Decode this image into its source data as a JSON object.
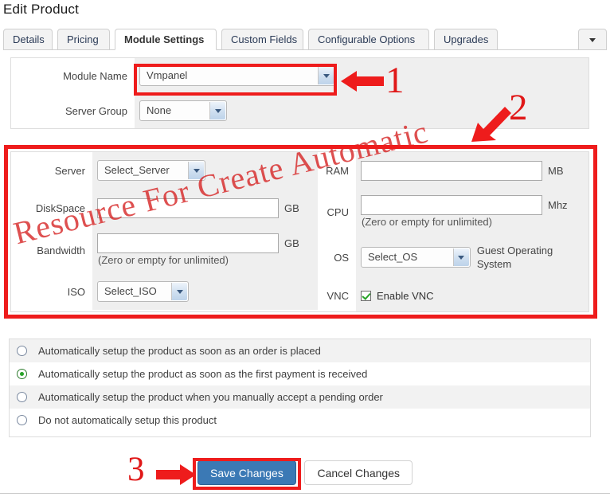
{
  "header": {
    "title": "Edit Product"
  },
  "tabs": {
    "items": [
      {
        "label": "Details",
        "active": false
      },
      {
        "label": "Pricing",
        "active": false
      },
      {
        "label": "Module Settings",
        "active": true
      },
      {
        "label": "Custom Fields",
        "active": false
      },
      {
        "label": "Configurable Options",
        "active": false
      },
      {
        "label": "Upgrades",
        "active": false
      }
    ],
    "overflow_icon": "chevron-down-icon"
  },
  "module_panel": {
    "module_name": {
      "label": "Module Name",
      "value": "Vmpanel"
    },
    "server_group": {
      "label": "Server Group",
      "value": "None"
    }
  },
  "resource_panel": {
    "server": {
      "label": "Server",
      "value": "Select_Server"
    },
    "diskspace": {
      "label": "DiskSpace",
      "value": "",
      "unit": "GB"
    },
    "bandwidth": {
      "label": "Bandwidth",
      "value": "",
      "unit": "GB",
      "hint": "(Zero or empty for unlimited)"
    },
    "iso": {
      "label": "ISO",
      "value": "Select_ISO"
    },
    "ram": {
      "label": "RAM",
      "value": "",
      "unit": "MB"
    },
    "cpu": {
      "label": "CPU",
      "value": "",
      "unit": "Mhz",
      "hint": "(Zero or empty for unlimited)"
    },
    "os": {
      "label": "OS",
      "value": "Select_OS",
      "note": "Guest Operating System"
    },
    "vnc": {
      "label": "VNC",
      "checkbox_label": "Enable VNC",
      "checked": true
    }
  },
  "autosetup": {
    "options": [
      {
        "label": "Automatically setup the product as soon as an order is placed",
        "selected": false
      },
      {
        "label": "Automatically setup the product as soon as the first payment is received",
        "selected": true
      },
      {
        "label": "Automatically setup the product when you manually accept a pending order",
        "selected": false
      },
      {
        "label": "Do not automatically setup this product",
        "selected": false
      }
    ]
  },
  "footer": {
    "save_label": "Save Changes",
    "cancel_label": "Cancel Changes"
  },
  "annotations": {
    "color": "#ee1c1c",
    "step1": "1",
    "step2": "2",
    "step3": "3",
    "watermark": "Resource For Create Automatic"
  }
}
